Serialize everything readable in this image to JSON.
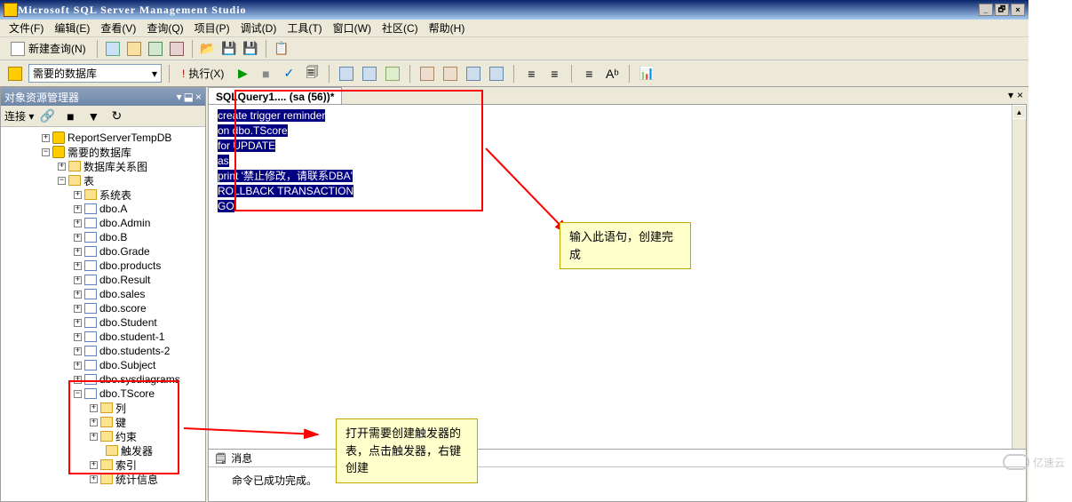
{
  "window": {
    "title": "Microsoft SQL Server Management Studio",
    "min": "_",
    "max": "▢",
    "restore": "🗗",
    "close": "×"
  },
  "menu": {
    "file": "文件(F)",
    "edit": "编辑(E)",
    "view": "查看(V)",
    "query": "查询(Q)",
    "project": "项目(P)",
    "debug": "调试(D)",
    "tools": "工具(T)",
    "window": "窗口(W)",
    "community": "社区(C)",
    "help": "帮助(H)"
  },
  "toolbar": {
    "new_query": "新建查询(N)",
    "execute": "执行(X)",
    "play": "▶",
    "check": "✓"
  },
  "dbselect": {
    "value": "需要的数据库",
    "arrow": "▾"
  },
  "panel": {
    "title": "对象资源管理器",
    "pin": "▾ 📌 ×",
    "connect": "连接 ▾"
  },
  "tree": {
    "n1": "ReportServerTempDB",
    "n2": "需要的数据库",
    "n3": "数据库关系图",
    "n4": "表",
    "n5": "系统表",
    "t1": "dbo.A",
    "t2": "dbo.Admin",
    "t3": "dbo.B",
    "t4": "dbo.Grade",
    "t5": "dbo.products",
    "t6": "dbo.Result",
    "t7": "dbo.sales",
    "t8": "dbo.score",
    "t9": "dbo.Student",
    "t10": "dbo.student-1",
    "t11": "dbo.students-2",
    "t12": "dbo.Subject",
    "t13": "dbo.sysdiagrams",
    "t14": "dbo.TScore",
    "c1": "列",
    "c2": "键",
    "c3": "约束",
    "c4": "触发器",
    "c5": "索引",
    "c6": "统计信息"
  },
  "tab": {
    "label": "SQLQuery1.... (sa (56))*",
    "close": "×"
  },
  "code": {
    "l1": "create trigger reminder",
    "l2": "on dbo.TScore",
    "l3": "for UPDATE",
    "l4": "as",
    "l5": "print '禁止修改，请联系DBA'",
    "l6": "ROLLBACK TRANSACTION",
    "l7": "GO"
  },
  "msg": {
    "tab": "消息",
    "body": "命令已成功完成。"
  },
  "anno": {
    "a1": "输入此语句，创建完成",
    "a2": "打开需要创建触发器的表，点击触发器，右键创建"
  },
  "watermark": "亿速云",
  "tbclose_x": "×",
  "tbclose_d": "▾"
}
